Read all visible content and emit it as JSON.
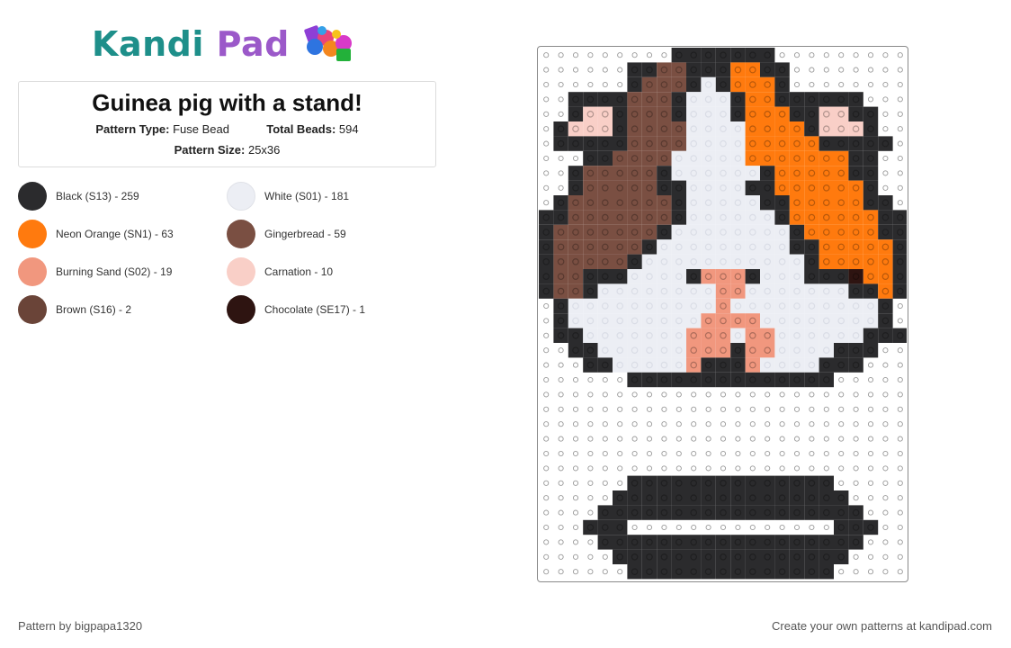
{
  "logo": {
    "part1": "Kandi",
    "part2": "Pad"
  },
  "pattern": {
    "title": "Guinea pig with a stand!",
    "type_label": "Pattern Type:",
    "type_value": "Fuse Bead",
    "beads_label": "Total Beads:",
    "beads_value": "594",
    "size_label": "Pattern Size:",
    "size_value": "25x36"
  },
  "legend": [
    {
      "label": "Black (S13) - 259",
      "color": "#2b2b2d"
    },
    {
      "label": "White (S01) - 181",
      "color": "#eceef4"
    },
    {
      "label": "Neon Orange (SN1) - 63",
      "color": "#ff7a0e"
    },
    {
      "label": "Gingerbread - 59",
      "color": "#7a4f42"
    },
    {
      "label": "Burning Sand (S02) - 19",
      "color": "#f1977e"
    },
    {
      "label": "Carnation - 10",
      "color": "#f9cfc7"
    },
    {
      "label": "Brown (S16) - 2",
      "color": "#6a4438"
    },
    {
      "label": "Chocolate (SE17) - 1",
      "color": "#2e1411"
    }
  ],
  "board": {
    "palette": {
      "K": "#2b2b2d",
      "W": "#eceef4",
      "O": "#ff7a0e",
      "G": "#7a4f42",
      "S": "#f1977e",
      "C": "#f9cfc7",
      "B": "#6a4438",
      "H": "#2e1411"
    },
    "rows": [
      ".........KKKKKKK.........",
      "......KKGGKKKOOKK........",
      "......KGGGKWKOOOK........",
      "..KKKKGGGKWWWKOOKKKKKK...",
      "..KCCKGGGKWWWKOOOKKCCKK..",
      ".KCCCKGGGGWWWWOOOOKCCCK..",
      ".KKKKKGGGGWWWWOOOOOKKKKK.",
      "...KKGGGGWWWWWOOOOOOOKK..",
      "..KGGGGGKWWWWWWKOOOOOKK..",
      "..KGGGGGKKWWWWKKOOOOOOK..",
      ".KGGGGGGGKWWWWWKKOOOOOKK.",
      "KKGGGGGGGKWWWWWWKOOOOOOKK",
      "KGGGGGGGKWWWWWWWWKOOOOOKK",
      "KGGGGGGKWWWWWWWWWKKOOOOOK",
      "KGGGGGKWWWWWWWWWWWKOOOOOK",
      "KGGKKKWWWWKSSSKWWWKKKHOOK",
      "KGGKWWWWWWWWSSWWWWWWWKKOK",
      ".KWWWWWWWWWWSWWWWWWWWWWK.",
      ".KWWWWWWWWWSSSSWWWWWWWWK.",
      ".KKWWWWWWWSSSWSSWWWWWWKKK",
      "..KKWWWWWWSSSKSSWWWWKKK..",
      "...KKWWWWWSKKKSWWWWKKK...",
      "......KKKKKKKKKKKKKK.....",
      ".........................",
      ".........................",
      ".........................",
      ".........................",
      ".........................",
      ".........................",
      "......KKKKKKKKKKKKKK.....",
      ".....KKKKKKKKKKKKKKKK....",
      "....KKKKKKKKKKKKKKKKKK...",
      "...KKK..............KKK..",
      "....KKKKKKKKKKKKKKKKKK...",
      ".....KKKKKKKKKKKKKKKK....",
      "......KKKKKKKKKKKKKK....."
    ]
  },
  "footer": {
    "credit": "Pattern by bigpapa1320",
    "cta": "Create your own patterns at kandipad.com"
  }
}
